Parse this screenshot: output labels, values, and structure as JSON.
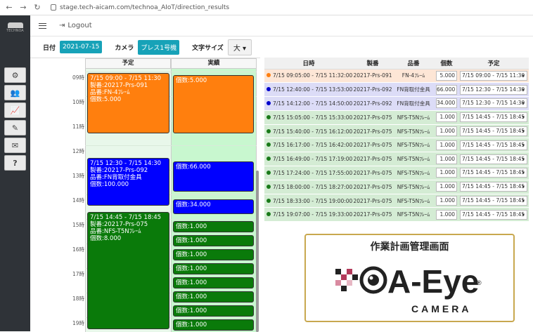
{
  "browser": {
    "url": "stage.tech-aicam.com/technoa_AIoT/direction_results"
  },
  "sidebar": {
    "logo": "TECHNOA"
  },
  "topbar": {
    "logout": "Logout"
  },
  "filters": {
    "date_label": "日付",
    "date_value": "2021-07-15",
    "camera_label": "カメラ",
    "camera_value": "プレス1号機",
    "fontsize_label": "文字サイズ",
    "fontsize_value": "大 ▾"
  },
  "schedule": {
    "plan_header": "予定",
    "actual_header": "実績",
    "hours": [
      "09時",
      "10時",
      "11時",
      "12時",
      "13時",
      "14時",
      "15時",
      "16時",
      "17時",
      "18時",
      "19時"
    ],
    "plans": [
      {
        "line1": "7/15 09:00 - 7/15 11:30",
        "line2": "製番:20217-Prs-091",
        "line3": "品番:FN-4ﾌﾚｰﾑ",
        "line4": "個数:5.000",
        "color": "#ff7f0e"
      },
      {
        "line1": "7/15 12:30 - 7/15 14:30",
        "line2": "製番:20217-Prs-092",
        "line3": "品番:FN背取付金具",
        "line4": "個数:100.000",
        "color": "#0000ff"
      },
      {
        "line1": "7/15 14:45 - 7/15 18:45",
        "line2": "製番:20217-Prs-075",
        "line3": "品番:NFS-T5Nﾌﾚｰﾑ",
        "line4": "個数:8.000",
        "color": "#0a7a0a"
      }
    ],
    "actuals": [
      {
        "text": "個数:5.000",
        "color": "#ff7f0e"
      },
      {
        "text": "個数:66.000",
        "color": "#0000ff"
      },
      {
        "text": "個数:34.000",
        "color": "#0000ff"
      },
      {
        "text": "個数:1.000",
        "color": "#0a7a0a"
      },
      {
        "text": "個数:1.000",
        "color": "#0a7a0a"
      },
      {
        "text": "個数:1.000",
        "color": "#0a7a0a"
      },
      {
        "text": "個数:1.000",
        "color": "#0a7a0a"
      },
      {
        "text": "個数:1.000",
        "color": "#0a7a0a"
      },
      {
        "text": "個数:1.000",
        "color": "#0a7a0a"
      },
      {
        "text": "個数:1.000",
        "color": "#0a7a0a"
      },
      {
        "text": "個数:1.000",
        "color": "#0a7a0a"
      }
    ]
  },
  "table": {
    "headers": [
      "日時",
      "製番",
      "品番",
      "個数",
      "予定"
    ],
    "rows": [
      {
        "time": "7/15 09:05:00 - 7/15 11:32:00",
        "seiban": "20217-Prs-091",
        "hinban": "FN-4ﾌﾚｰﾑ",
        "qty": "5.000",
        "plan": "7/15 09:00 - 7/15 11:30",
        "dot": "#ff7f0e",
        "bg": "#fde6d6"
      },
      {
        "time": "7/15 12:40:00 - 7/15 13:53:00",
        "seiban": "20217-Prs-092",
        "hinban": "FN背取付金具",
        "qty": "66.000",
        "plan": "7/15 12:30 - 7/15 14:30",
        "dot": "#0000cc",
        "bg": "#dcdcf7"
      },
      {
        "time": "7/15 14:12:00 - 7/15 14:50:00",
        "seiban": "20217-Prs-092",
        "hinban": "FN背取付金具",
        "qty": "34.000",
        "plan": "7/15 12:30 - 7/15 14:30",
        "dot": "#0000cc",
        "bg": "#dcdcf7"
      },
      {
        "time": "7/15 15:05:00 - 7/15 15:33:00",
        "seiban": "20217-Prs-075",
        "hinban": "NFS-T5Nﾌﾚｰﾑ",
        "qty": "1.000",
        "plan": "7/15 14:45 - 7/15 18:45",
        "dot": "#1a7a1a",
        "bg": "#d4ecd4"
      },
      {
        "time": "7/15 15:40:00 - 7/15 16:12:00",
        "seiban": "20217-Prs-075",
        "hinban": "NFS-T5Nﾌﾚｰﾑ",
        "qty": "1.000",
        "plan": "7/15 14:45 - 7/15 18:45",
        "dot": "#1a7a1a",
        "bg": "#d4ecd4"
      },
      {
        "time": "7/15 16:17:00 - 7/15 16:42:00",
        "seiban": "20217-Prs-075",
        "hinban": "NFS-T5Nﾌﾚｰﾑ",
        "qty": "1.000",
        "plan": "7/15 14:45 - 7/15 18:45",
        "dot": "#1a7a1a",
        "bg": "#d4ecd4"
      },
      {
        "time": "7/15 16:49:00 - 7/15 17:19:00",
        "seiban": "20217-Prs-075",
        "hinban": "NFS-T5Nﾌﾚｰﾑ",
        "qty": "1.000",
        "plan": "7/15 14:45 - 7/15 18:45",
        "dot": "#1a7a1a",
        "bg": "#d4ecd4"
      },
      {
        "time": "7/15 17:24:00 - 7/15 17:55:00",
        "seiban": "20217-Prs-075",
        "hinban": "NFS-T5Nﾌﾚｰﾑ",
        "qty": "1.000",
        "plan": "7/15 14:45 - 7/15 18:45",
        "dot": "#1a7a1a",
        "bg": "#d4ecd4"
      },
      {
        "time": "7/15 18:00:00 - 7/15 18:27:00",
        "seiban": "20217-Prs-075",
        "hinban": "NFS-T5Nﾌﾚｰﾑ",
        "qty": "1.000",
        "plan": "7/15 14:45 - 7/15 18:45",
        "dot": "#1a7a1a",
        "bg": "#d4ecd4"
      },
      {
        "time": "7/15 18:33:00 - 7/15 19:00:00",
        "seiban": "20217-Prs-075",
        "hinban": "NFS-T5Nﾌﾚｰﾑ",
        "qty": "1.000",
        "plan": "7/15 14:45 - 7/15 18:45",
        "dot": "#1a7a1a",
        "bg": "#d4ecd4"
      },
      {
        "time": "7/15 19:07:00 - 7/15 19:33:00",
        "seiban": "20217-Prs-075",
        "hinban": "NFS-T5Nﾌﾚｰﾑ",
        "qty": "1.000",
        "plan": "7/15 14:45 - 7/15 18:45",
        "dot": "#1a7a1a",
        "bg": "#d4ecd4"
      }
    ]
  },
  "banner": {
    "title": "作業計画管理画面",
    "brand": "A-Eye",
    "sub": "CAMERA"
  }
}
